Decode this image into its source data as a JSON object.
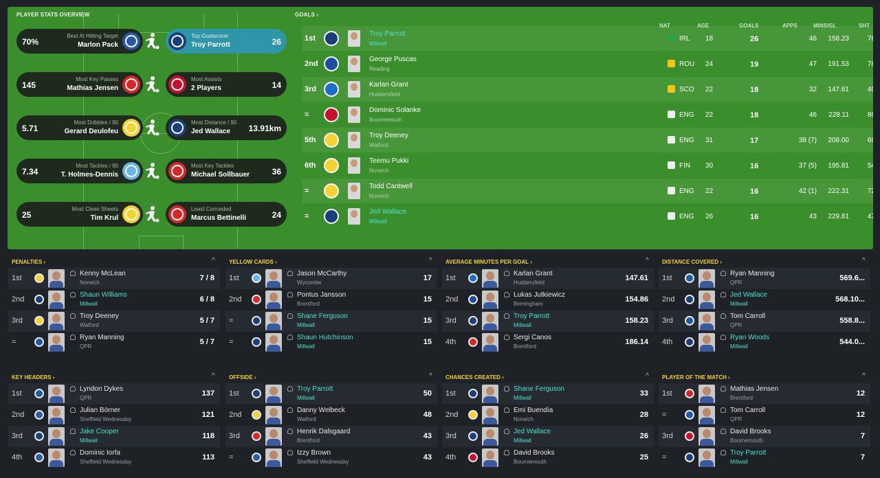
{
  "overview": {
    "title": "PLAYER STATS OVERVIEW",
    "awards": [
      {
        "left": {
          "caption": "Best At Hitting Target",
          "name": "Marlon Pack",
          "value": "70%",
          "badge": "cardiff-badge",
          "color": "#2957a4"
        },
        "right": {
          "caption": "Top Goalscorer",
          "name": "Troy Parrott",
          "value": "26",
          "badge": "millwall-badge",
          "color": "#1b3f7a",
          "highlight": true
        },
        "icon": "shooting-player-icon"
      },
      {
        "left": {
          "caption": "Most Key Passes",
          "name": "Mathias Jensen",
          "value": "145",
          "badge": "brentford-badge",
          "color": "#d8262b"
        },
        "right": {
          "caption": "Most Assists",
          "name": "2 Players",
          "value": "14",
          "badge": "bournemouth-badge",
          "color": "#c8102e"
        },
        "icon": "passing-player-icon"
      },
      {
        "left": {
          "caption": "Most Dribbles / 90",
          "name": "Gerard Deulofeu",
          "value": "5.71",
          "badge": "watford-badge",
          "color": "#f5d232"
        },
        "right": {
          "caption": "Most Distance / 90",
          "name": "Jed Wallace",
          "value": "13.91km",
          "badge": "millwall-badge",
          "color": "#1b3f7a"
        },
        "icon": "running-player-icon"
      },
      {
        "left": {
          "caption": "Most Tackles / 90",
          "name": "T. Holmes-Dennis",
          "value": "7.34",
          "badge": "wycombe-badge",
          "color": "#6cb4e4"
        },
        "right": {
          "caption": "Most Key Tackles",
          "name": "Michael Sollbauer",
          "value": "36",
          "badge": "barnsley-badge",
          "color": "#d8262b"
        },
        "icon": "tackling-player-icon"
      },
      {
        "left": {
          "caption": "Most Clean Sheets",
          "name": "Tim Krul",
          "value": "25",
          "badge": "norwich-badge",
          "color": "#f5d232"
        },
        "right": {
          "caption": "Least Conceded",
          "name": "Marcus Bettinelli",
          "value": "24",
          "badge": "middlesbrough-badge",
          "color": "#d8262b"
        },
        "icon": "diving-keeper-icon"
      }
    ]
  },
  "goals": {
    "title": "GOALS",
    "headers": {
      "nat": "NAT",
      "age": "AGE",
      "goals": "GOALS",
      "apps": "APPS",
      "mins_gl": "MINS/GL",
      "sht": "SHT"
    },
    "rows": [
      {
        "pos": "1st",
        "name": "Troy Parrott",
        "club": "Millwall",
        "link": true,
        "nat": "IRL",
        "flag": "#2f9e4a",
        "age": "18",
        "goals": "26",
        "apps": "46",
        "mins_gl": "158.23",
        "sht": "76",
        "badge": "#1b3f7a"
      },
      {
        "pos": "2nd",
        "name": "George Puscas",
        "club": "Reading",
        "link": false,
        "nat": "ROU",
        "flag": "#f5c518",
        "age": "24",
        "goals": "19",
        "apps": "47",
        "mins_gl": "191.53",
        "sht": "78",
        "badge": "#1d4fa0"
      },
      {
        "pos": "3rd",
        "name": "Karlan Grant",
        "club": "Huddersfield",
        "link": false,
        "nat": "SCO",
        "flag": "#f5c518",
        "age": "22",
        "goals": "18",
        "apps": "32",
        "mins_gl": "147.61",
        "sht": "49",
        "badge": "#1e6ec8"
      },
      {
        "pos": "=",
        "name": "Dominic Solanke",
        "club": "Bournemouth",
        "link": false,
        "nat": "ENG",
        "flag": "#eeeeee",
        "age": "22",
        "goals": "18",
        "apps": "46",
        "mins_gl": "228.11",
        "sht": "86",
        "badge": "#c8102e"
      },
      {
        "pos": "5th",
        "name": "Troy Deeney",
        "club": "Watford",
        "link": false,
        "nat": "ENG",
        "flag": "#eeeeee",
        "age": "31",
        "goals": "17",
        "apps": "38 (7)",
        "mins_gl": "208.00",
        "sht": "66",
        "badge": "#f5d232"
      },
      {
        "pos": "6th",
        "name": "Teemu Pukki",
        "club": "Norwich",
        "link": false,
        "nat": "FIN",
        "flag": "#eeeeee",
        "age": "30",
        "goals": "16",
        "apps": "37 (5)",
        "mins_gl": "195.81",
        "sht": "54",
        "badge": "#f5d232"
      },
      {
        "pos": "=",
        "name": "Todd Cantwell",
        "club": "Norwich",
        "link": false,
        "nat": "ENG",
        "flag": "#eeeeee",
        "age": "22",
        "goals": "16",
        "apps": "42 (1)",
        "mins_gl": "222.31",
        "sht": "72",
        "badge": "#f5d232"
      },
      {
        "pos": "=",
        "name": "Jed Wallace",
        "club": "Millwall",
        "link": true,
        "nat": "ENG",
        "flag": "#eeeeee",
        "age": "26",
        "goals": "16",
        "apps": "43",
        "mins_gl": "229.81",
        "sht": "47",
        "badge": "#1b3f7a"
      }
    ]
  },
  "cards": [
    {
      "title": "PENALTIES",
      "rows": [
        {
          "rank": "1st",
          "name": "Kenny McLean",
          "club": "Norwich",
          "link": false,
          "value": "7 / 8",
          "badge": "#f5d232"
        },
        {
          "rank": "2nd",
          "name": "Shaun Williams",
          "club": "Millwall",
          "link": true,
          "value": "6 / 8",
          "badge": "#1b3f7a"
        },
        {
          "rank": "3rd",
          "name": "Troy Deeney",
          "club": "Watford",
          "link": false,
          "value": "5 / 7",
          "badge": "#f5d232"
        },
        {
          "rank": "=",
          "name": "Ryan Manning",
          "club": "QPR",
          "link": false,
          "value": "5 / 7",
          "badge": "#1d5ba4"
        }
      ]
    },
    {
      "title": "YELLOW CARDS",
      "rows": [
        {
          "rank": "1st",
          "name": "Jason McCarthy",
          "club": "Wycombe",
          "link": false,
          "value": "17",
          "badge": "#6cb4e4"
        },
        {
          "rank": "2nd",
          "name": "Pontus Jansson",
          "club": "Brentford",
          "link": false,
          "value": "15",
          "badge": "#d8262b"
        },
        {
          "rank": "=",
          "name": "Shane Ferguson",
          "club": "Millwall",
          "link": true,
          "value": "15",
          "badge": "#1b3f7a"
        },
        {
          "rank": "=",
          "name": "Shaun Hutchinson",
          "club": "Millwall",
          "link": true,
          "value": "15",
          "badge": "#1b3f7a"
        }
      ]
    },
    {
      "title": "AVERAGE MINUTES PER GOAL",
      "rows": [
        {
          "rank": "1st",
          "name": "Karlan Grant",
          "club": "Huddersfield",
          "link": false,
          "value": "147.61",
          "badge": "#1e6ec8"
        },
        {
          "rank": "2nd",
          "name": "Lukas Jutkiewicz",
          "club": "Birmingham",
          "link": false,
          "value": "154.86",
          "badge": "#1d4fa0"
        },
        {
          "rank": "3rd",
          "name": "Troy Parrott",
          "club": "Millwall",
          "link": true,
          "value": "158.23",
          "badge": "#1b3f7a"
        },
        {
          "rank": "4th",
          "name": "Sergi Canos",
          "club": "Brentford",
          "link": false,
          "value": "186.14",
          "badge": "#d8262b"
        }
      ]
    },
    {
      "title": "DISTANCE COVERED",
      "rows": [
        {
          "rank": "1st",
          "name": "Ryan Manning",
          "club": "QPR",
          "link": false,
          "value": "569.6...",
          "badge": "#1d5ba4"
        },
        {
          "rank": "2nd",
          "name": "Jed Wallace",
          "club": "Millwall",
          "link": true,
          "value": "568.10...",
          "badge": "#1b3f7a"
        },
        {
          "rank": "3rd",
          "name": "Tom Carroll",
          "club": "QPR",
          "link": false,
          "value": "558.8...",
          "badge": "#1d5ba4"
        },
        {
          "rank": "4th",
          "name": "Ryan Woods",
          "club": "Millwall",
          "link": true,
          "value": "544.0...",
          "badge": "#1b3f7a"
        }
      ]
    },
    {
      "title": "KEY HEADERS",
      "rows": [
        {
          "rank": "1st",
          "name": "Lyndon Dykes",
          "club": "QPR",
          "link": false,
          "value": "137",
          "badge": "#1d5ba4"
        },
        {
          "rank": "2nd",
          "name": "Julian Börner",
          "club": "Sheffield Wednesday",
          "link": false,
          "value": "121",
          "badge": "#2c5fa8"
        },
        {
          "rank": "3rd",
          "name": "Jake Cooper",
          "club": "Millwall",
          "link": true,
          "value": "118",
          "badge": "#1b3f7a"
        },
        {
          "rank": "4th",
          "name": "Dominic Iorfa",
          "club": "Sheffield Wednesday",
          "link": false,
          "value": "113",
          "badge": "#2c5fa8"
        }
      ]
    },
    {
      "title": "OFFSIDE",
      "rows": [
        {
          "rank": "1st",
          "name": "Troy Parrott",
          "club": "Millwall",
          "link": true,
          "value": "50",
          "badge": "#1b3f7a"
        },
        {
          "rank": "2nd",
          "name": "Danny Welbeck",
          "club": "Watford",
          "link": false,
          "value": "48",
          "badge": "#f5d232"
        },
        {
          "rank": "3rd",
          "name": "Henrik Dalsgaard",
          "club": "Brentford",
          "link": false,
          "value": "43",
          "badge": "#d8262b"
        },
        {
          "rank": "=",
          "name": "Izzy Brown",
          "club": "Sheffield Wednesday",
          "link": false,
          "value": "43",
          "badge": "#2c5fa8"
        }
      ]
    },
    {
      "title": "CHANCES CREATED",
      "rows": [
        {
          "rank": "1st",
          "name": "Shane Ferguson",
          "club": "Millwall",
          "link": true,
          "value": "33",
          "badge": "#1b3f7a"
        },
        {
          "rank": "2nd",
          "name": "Emi Buendía",
          "club": "Norwich",
          "link": false,
          "value": "28",
          "badge": "#f5d232"
        },
        {
          "rank": "3rd",
          "name": "Jed Wallace",
          "club": "Millwall",
          "link": true,
          "value": "26",
          "badge": "#1b3f7a"
        },
        {
          "rank": "4th",
          "name": "David Brooks",
          "club": "Bournemouth",
          "link": false,
          "value": "25",
          "badge": "#c8102e"
        }
      ]
    },
    {
      "title": "PLAYER OF THE MATCH",
      "rows": [
        {
          "rank": "1st",
          "name": "Mathias Jensen",
          "club": "Brentford",
          "link": false,
          "value": "12",
          "badge": "#d8262b"
        },
        {
          "rank": "=",
          "name": "Tom Carroll",
          "club": "QPR",
          "link": false,
          "value": "12",
          "badge": "#1d5ba4"
        },
        {
          "rank": "3rd",
          "name": "David Brooks",
          "club": "Bournemouth",
          "link": false,
          "value": "7",
          "badge": "#c8102e"
        },
        {
          "rank": "=",
          "name": "Troy Parrott",
          "club": "Millwall",
          "link": true,
          "value": "7",
          "badge": "#1b3f7a"
        }
      ]
    }
  ],
  "ui": {
    "caret": "›",
    "collapse": "^"
  }
}
